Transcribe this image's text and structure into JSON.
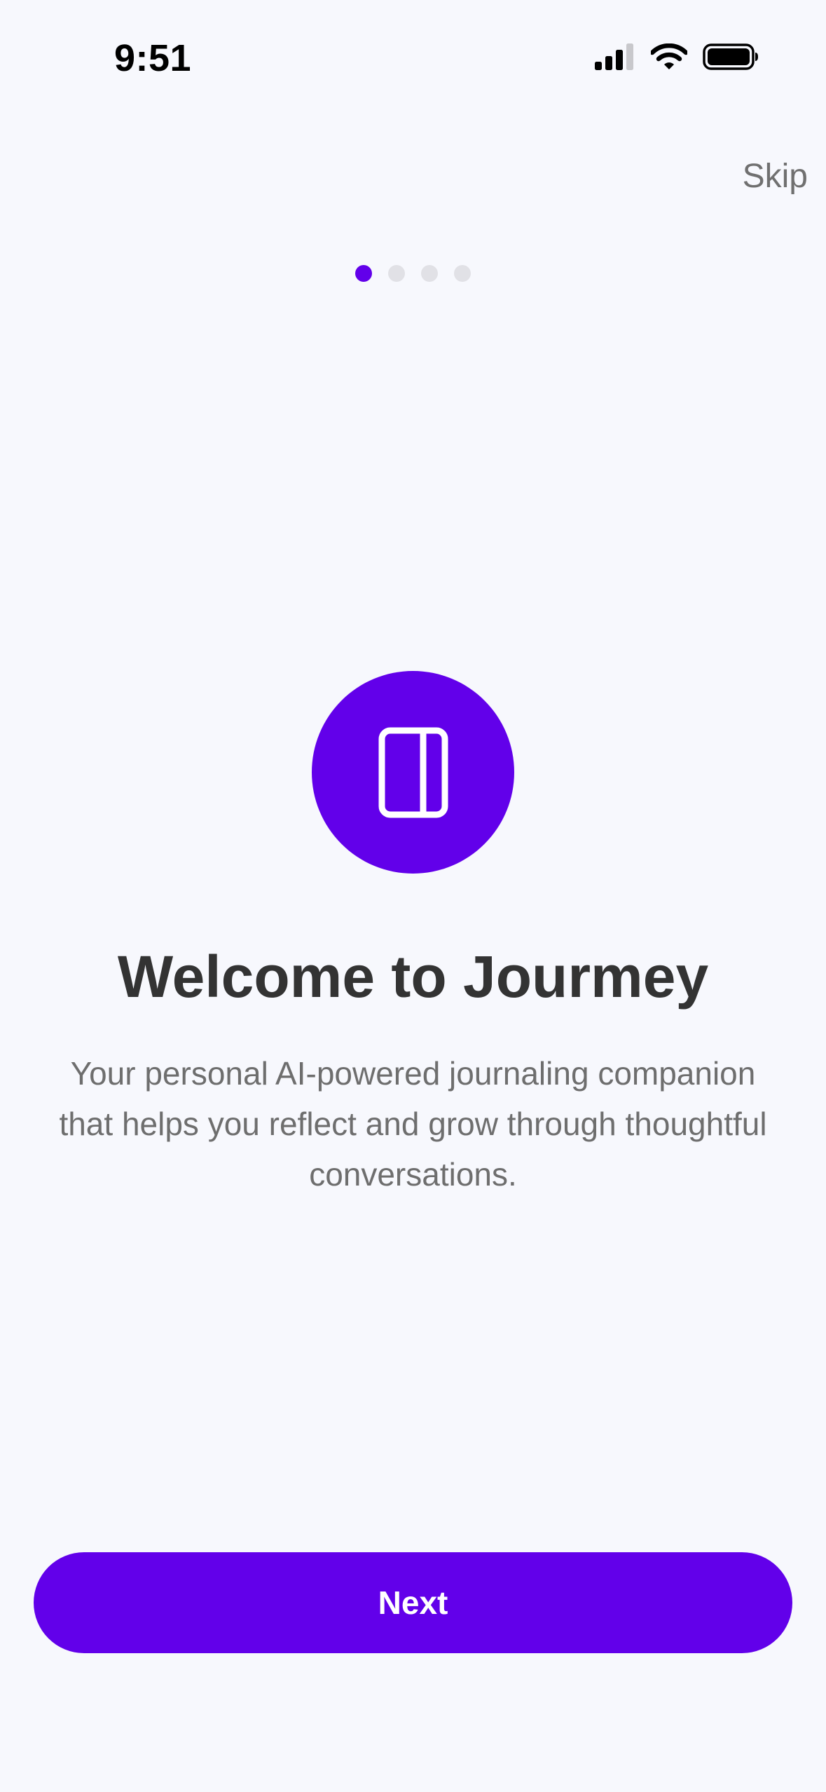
{
  "status_bar": {
    "time": "9:51",
    "icons": [
      "signal-icon",
      "wifi-icon",
      "battery-icon"
    ]
  },
  "header": {
    "skip_label": "Skip"
  },
  "pagination": {
    "total": 4,
    "current": 1
  },
  "hero": {
    "icon": "book-icon"
  },
  "content": {
    "title": "Welcome to Jourmey",
    "subtitle": "Your personal AI-powered journaling companion that helps you reflect and grow through thoughtful conversations."
  },
  "actions": {
    "next_label": "Next"
  },
  "colors": {
    "accent": "#6200ea",
    "background": "#f7f8fd",
    "title_text": "#333333",
    "body_text": "#6e6e6e",
    "dot_inactive": "#e1e1e6"
  }
}
